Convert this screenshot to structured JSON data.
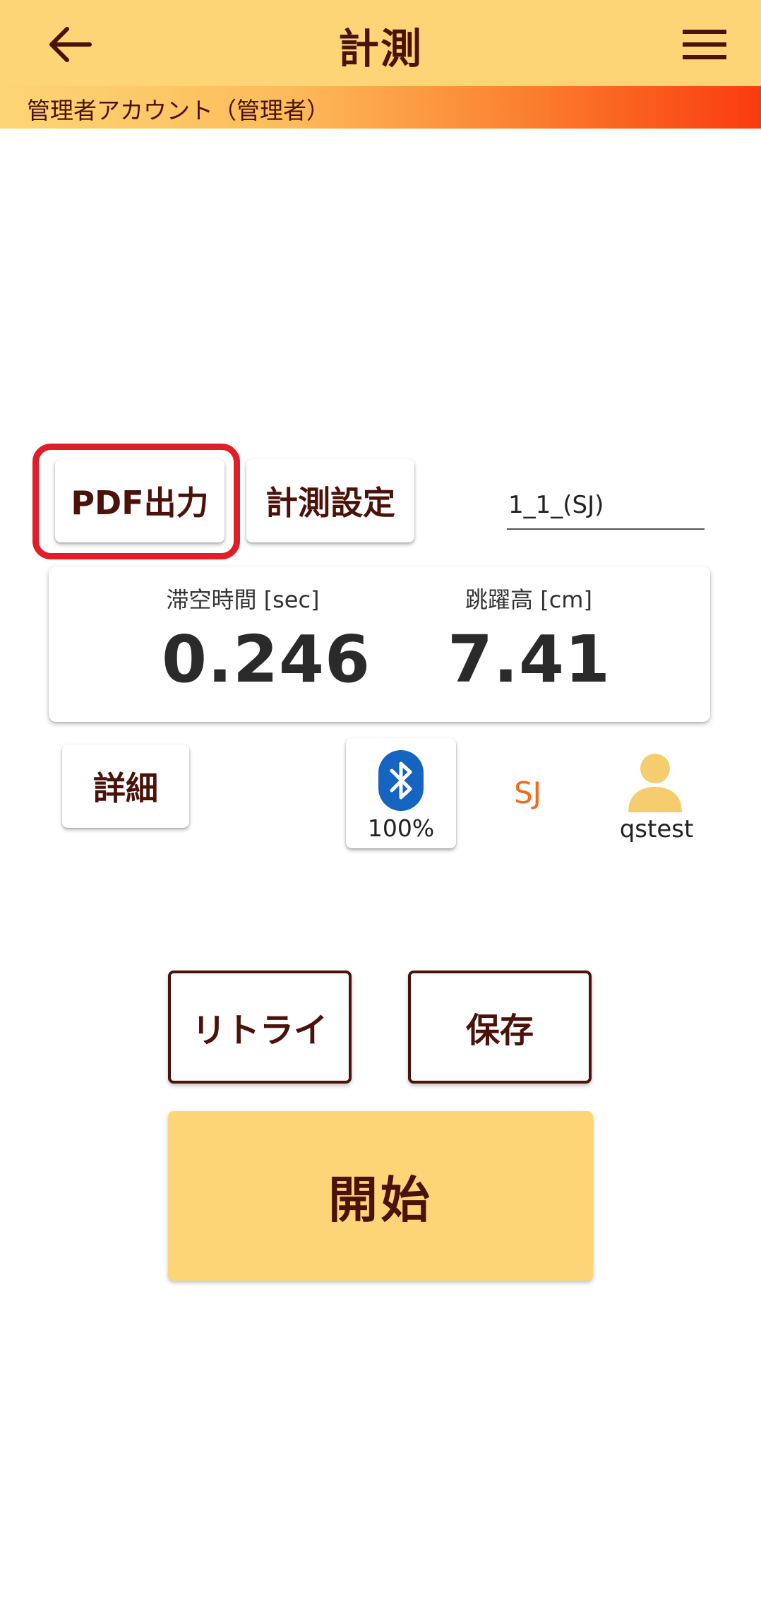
{
  "header": {
    "title": "計測",
    "back_icon": "arrow-left-icon",
    "menu_icon": "hamburger-menu-icon",
    "account": "管理者アカウント（管理者）"
  },
  "toolbar": {
    "pdf_label": "PDF出力",
    "settings_label": "計測設定",
    "trial_value": "1_1_(SJ)"
  },
  "results": {
    "flight_time_label": "滞空時間 [sec]",
    "flight_time_value": "0.246",
    "jump_height_label": "跳躍高 [cm]",
    "jump_height_value": "7.41"
  },
  "status": {
    "detail_label": "詳細",
    "bluetooth_icon": "bluetooth-icon",
    "battery": "100%",
    "mode": "SJ",
    "user_icon": "user-icon",
    "user_name": "qstest"
  },
  "actions": {
    "retry_label": "リトライ",
    "save_label": "保存",
    "start_label": "開始"
  },
  "colors": {
    "header_bg": "#fdd576",
    "text_dark": "#4a1208",
    "highlight": "#e11d2a",
    "bluetooth": "#1565c0",
    "mode_accent": "#f26a1b",
    "user_icon": "#f5cd6e"
  }
}
